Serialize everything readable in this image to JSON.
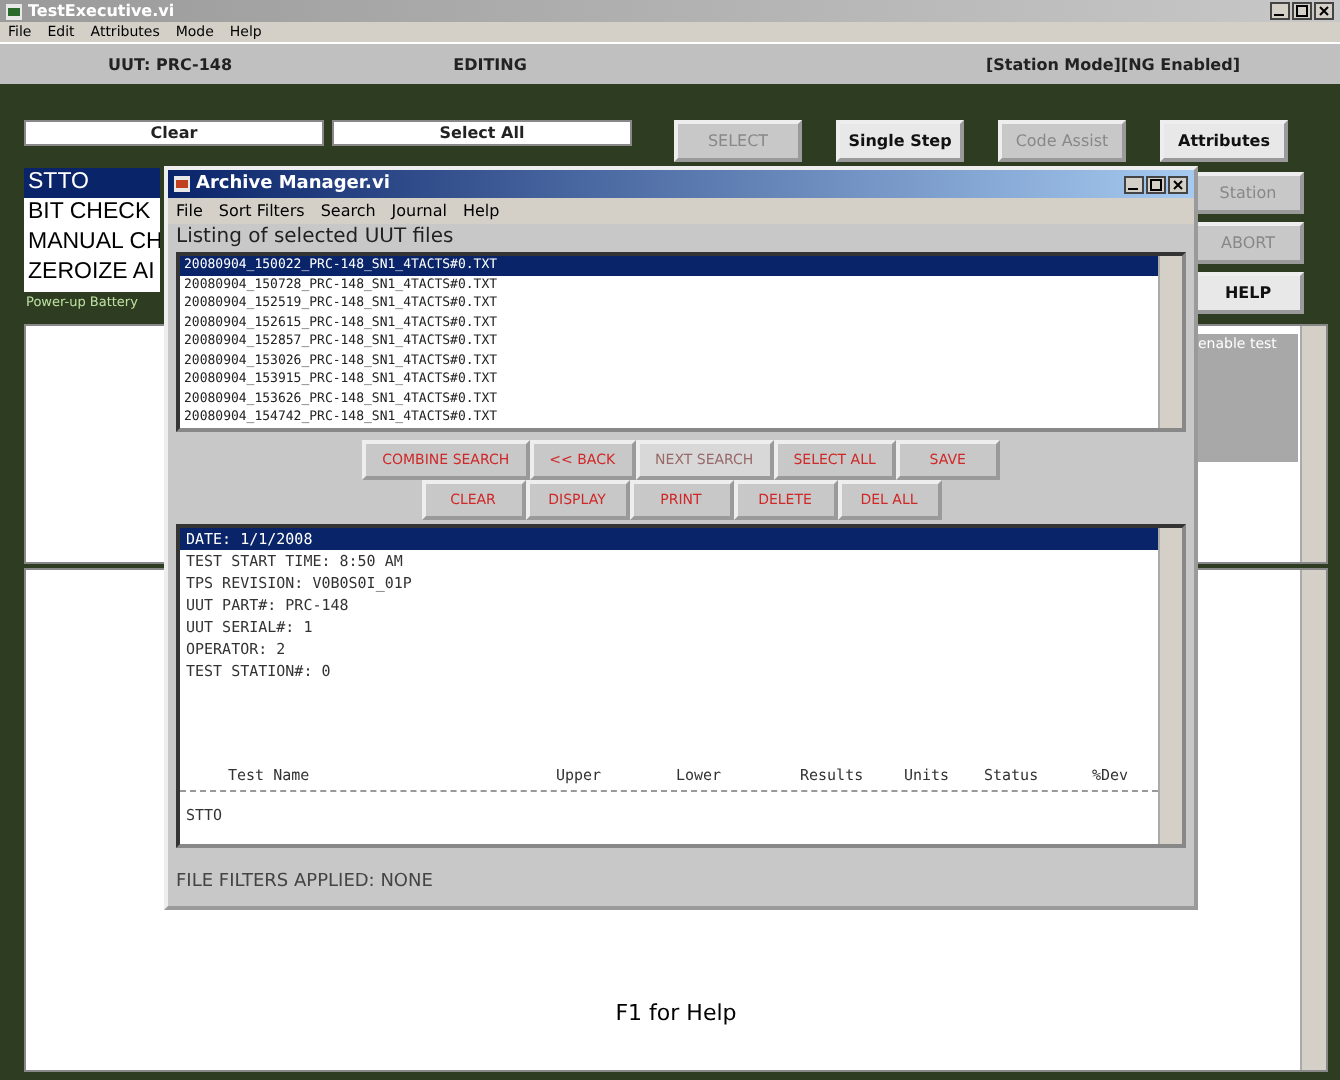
{
  "window": {
    "title": "TestExecutive.vi"
  },
  "menu": [
    "File",
    "Edit",
    "Attributes",
    "Mode",
    "Help"
  ],
  "status": {
    "uut": "UUT: PRC-148",
    "mode": "EDITING",
    "flags": "[Station Mode][NG Enabled]"
  },
  "list_buttons": [
    {
      "label": "Clear"
    },
    {
      "label": "Select All"
    }
  ],
  "toolbar": [
    {
      "label": "SELECT",
      "disabled": true
    },
    {
      "label": "Single Step",
      "disabled": false
    },
    {
      "label": "Code Assist",
      "disabled": true
    },
    {
      "label": "Attributes",
      "disabled": false
    }
  ],
  "side_buttons": [
    {
      "label": "Station",
      "disabled": true
    },
    {
      "label": "ABORT",
      "disabled": true
    },
    {
      "label": "HELP",
      "disabled": false
    }
  ],
  "tests": [
    {
      "label": "STTO",
      "selected": true
    },
    {
      "label": "BIT CHECK",
      "selected": false
    },
    {
      "label": "MANUAL CH",
      "selected": false
    },
    {
      "label": "ZEROIZE AI",
      "selected": false
    }
  ],
  "test_note": "Power-up Battery",
  "enable_label": "enable test",
  "help_text": "F1 for Help",
  "dialog": {
    "title": "Archive Manager.vi",
    "menu": [
      "File",
      "Sort Filters",
      "Search",
      "Journal",
      "Help"
    ],
    "listing_label": "Listing of selected UUT files",
    "files": [
      {
        "name": "20080904_150022_PRC-148_SN1_4TACTS#0.TXT",
        "selected": true
      },
      {
        "name": "20080904_150728_PRC-148_SN1_4TACTS#0.TXT",
        "selected": false
      },
      {
        "name": "20080904_152519_PRC-148_SN1_4TACTS#0.TXT",
        "selected": false
      },
      {
        "name": "20080904_152615_PRC-148_SN1_4TACTS#0.TXT",
        "selected": false
      },
      {
        "name": "20080904_152857_PRC-148_SN1_4TACTS#0.TXT",
        "selected": false
      },
      {
        "name": "20080904_153026_PRC-148_SN1_4TACTS#0.TXT",
        "selected": false
      },
      {
        "name": "20080904_153915_PRC-148_SN1_4TACTS#0.TXT",
        "selected": false
      },
      {
        "name": "20080904_153626_PRC-148_SN1_4TACTS#0.TXT",
        "selected": false
      },
      {
        "name": "20080904_154742_PRC-148_SN1_4TACTS#0.TXT",
        "selected": false
      }
    ],
    "buttons_row_1": [
      {
        "label": "COMBINE SEARCH",
        "disabled": false
      },
      {
        "label": "<< BACK",
        "disabled": false
      },
      {
        "label": "NEXT SEARCH",
        "disabled": true
      },
      {
        "label": "SELECT ALL",
        "disabled": false
      },
      {
        "label": "SAVE",
        "disabled": false
      }
    ],
    "buttons_row_2": [
      {
        "label": "CLEAR",
        "disabled": false
      },
      {
        "label": "DISPLAY",
        "disabled": false
      },
      {
        "label": "PRINT",
        "disabled": false
      },
      {
        "label": "DELETE",
        "disabled": false
      },
      {
        "label": "DEL ALL",
        "disabled": false
      }
    ],
    "report_lines": [
      {
        "text": "DATE: 1/1/2008",
        "selected": true
      },
      {
        "text": "TEST START TIME: 8:50 AM",
        "selected": false
      },
      {
        "text": "TPS REVISION: V0B0S0I_01P",
        "selected": false
      },
      {
        "text": "UUT PART#: PRC-148",
        "selected": false
      },
      {
        "text": "UUT SERIAL#: 1",
        "selected": false
      },
      {
        "text": "OPERATOR: 2",
        "selected": false
      },
      {
        "text": "TEST STATION#: 0",
        "selected": false
      }
    ],
    "report_columns": [
      "Test Name",
      "Upper",
      "Lower",
      "Results",
      "Units",
      "Status",
      "%Dev"
    ],
    "report_rows": [
      "STTO"
    ],
    "filters": "FILE FILTERS APPLIED: NONE"
  }
}
